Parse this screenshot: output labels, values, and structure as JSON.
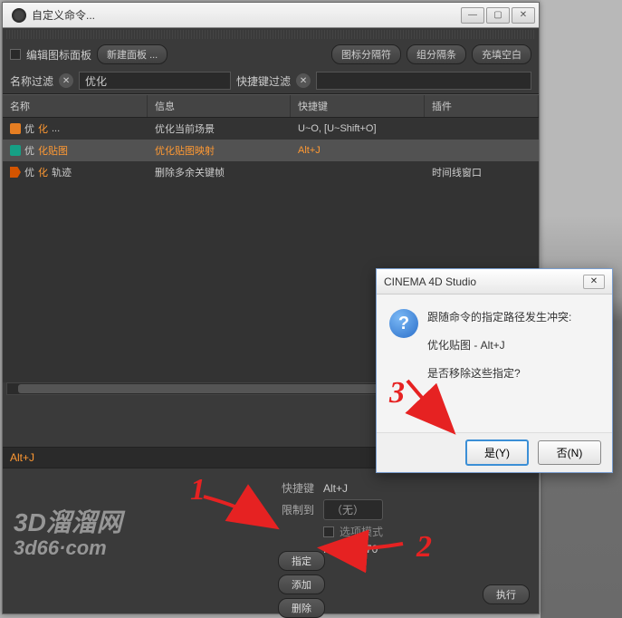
{
  "window": {
    "title": "自定义命令...",
    "edit_panel_label": "编辑图标面板",
    "new_panel_btn": "新建面板 ...",
    "icon_separator_btn": "图标分隔符",
    "group_bar_btn": "组分隔条",
    "fill_space_btn": "充填空白"
  },
  "filters": {
    "name_label": "名称过滤",
    "name_value": "优化",
    "shortcut_label": "快捷键过滤",
    "shortcut_value": ""
  },
  "table": {
    "headers": {
      "name": "名称",
      "info": "信息",
      "shortcut": "快捷键",
      "plugin": "插件"
    },
    "rows": [
      {
        "name_pre": "优",
        "name_hl": "化",
        "name_post": "...",
        "info": "优化当前场景",
        "shortcut": "U~O, [U~Shift+O]",
        "plugin": "",
        "icon": "orange"
      },
      {
        "name_pre": "优",
        "name_hl": "化贴图",
        "name_post": "",
        "info_hl": "优化贴图映射",
        "shortcut_hl": "Alt+J",
        "plugin": "",
        "selected": true,
        "icon": "teal"
      },
      {
        "name_pre": "优",
        "name_hl": "化",
        "name_post": "轨迹",
        "info": "删除多余关键帧",
        "shortcut": "",
        "plugin": "时间线窗口",
        "icon": "arrow"
      }
    ]
  },
  "detail": {
    "current_shortcut": "Alt+J",
    "shortcut_label": "快捷键",
    "shortcut_value": "Alt+J",
    "restrict_label": "限制到",
    "restrict_value": "（无）",
    "option_mode_label": "选项模式",
    "id_label": "ID 1011170",
    "buttons": {
      "assign": "指定",
      "add": "添加",
      "delete": "删除",
      "execute": "执行"
    }
  },
  "modal": {
    "title": "CINEMA 4D Studio",
    "line1": "跟随命令的指定路径发生冲突:",
    "line2": "优化贴图 - Alt+J",
    "line3": "是否移除这些指定?",
    "yes": "是(Y)",
    "no": "否(N)"
  },
  "watermark": {
    "line1": "3D溜溜网",
    "line2": "3d66·com"
  },
  "annotations": {
    "n1": "1",
    "n2": "2",
    "n3": "3"
  }
}
